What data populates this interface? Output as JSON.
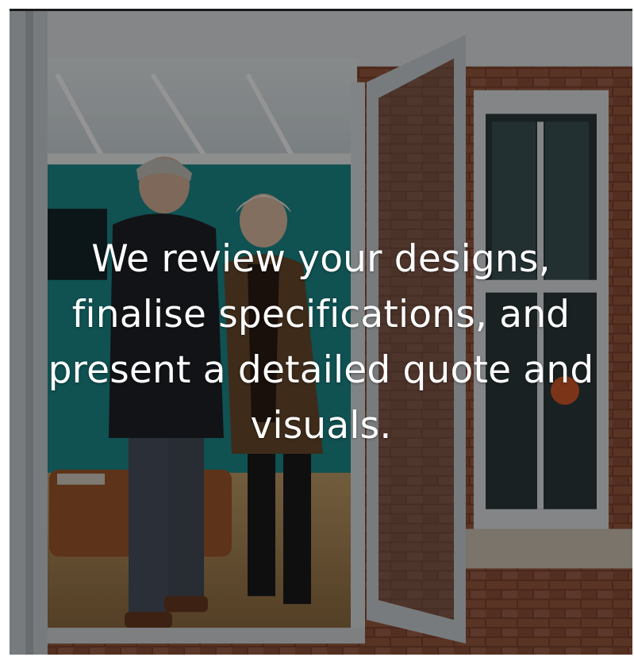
{
  "caption": {
    "text": "We review your designs, finalise specifications, and present a detailed quote and visuals."
  },
  "colors": {
    "overlay": "#000000",
    "caption_text": "#ffffff",
    "brick": "#8a4b34",
    "teal_wall": "#1c8a8c",
    "frame": "#d9dde0"
  }
}
